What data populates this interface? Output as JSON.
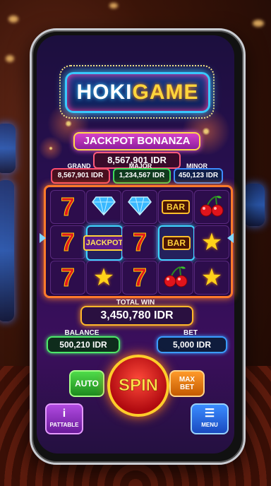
{
  "logo": {
    "part1": "HOKI",
    "part2": "GAME"
  },
  "jackpot": {
    "title": "JACKPOT BONANZA",
    "amount": "8,567,901 IDR",
    "tiers": [
      {
        "label": "GRAND",
        "amount": "8,567,901 IDR"
      },
      {
        "label": "MAJOR",
        "amount": "1,234,567 IDR"
      },
      {
        "label": "MINOR",
        "amount": "450,123 IDR"
      }
    ]
  },
  "reels": {
    "rows": [
      [
        "seven",
        "diamond",
        "diamond",
        "bar",
        "cherry"
      ],
      [
        "seven",
        "jackpot",
        "seven",
        "bar",
        "star"
      ],
      [
        "seven",
        "star",
        "seven",
        "cherry",
        "star"
      ]
    ],
    "bar_text": "BAR",
    "jackpot_text": "JACKPOT",
    "seven_text": "7"
  },
  "win": {
    "label": "TOTAL WIN",
    "amount": "3,450,780 IDR"
  },
  "balance": {
    "label": "BALANCE",
    "value": "500,210 IDR"
  },
  "bet": {
    "label": "BET",
    "value": "5,000 IDR"
  },
  "controls": {
    "auto": "AUTO",
    "spin": "SPIN",
    "max_bet_line1": "MAX",
    "max_bet_line2": "BET"
  },
  "footer": {
    "paytable": "PATTABLE",
    "paytable_icon": "i",
    "menu": "MENU",
    "menu_icon": "☰"
  },
  "colors": {
    "accent_cyan": "#38c8ff",
    "accent_gold": "#ffd53c",
    "spin_red": "#d0101a"
  }
}
